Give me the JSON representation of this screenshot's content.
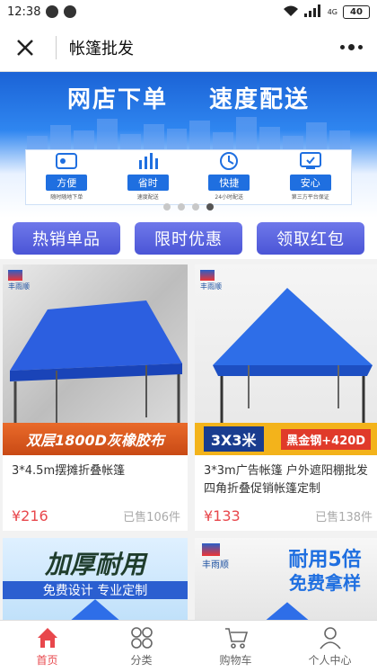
{
  "status": {
    "time": "12:38",
    "battery": "40",
    "network": "4G"
  },
  "nav": {
    "title": "帐篷批发"
  },
  "banner": {
    "headline_left": "网店下单",
    "headline_right": "速度配送",
    "features": [
      {
        "tag": "方便",
        "sub": "随时随地下单",
        "icon": "document-icon"
      },
      {
        "tag": "省时",
        "sub": "速度配送",
        "icon": "chart-icon"
      },
      {
        "tag": "快捷",
        "sub": "24小时配送",
        "icon": "truck-icon"
      },
      {
        "tag": "安心",
        "sub": "第三方平台保证",
        "icon": "monitor-icon"
      }
    ]
  },
  "quick_buttons": [
    "热销单品",
    "限时优惠",
    "领取红包"
  ],
  "products": [
    {
      "name": "3*4.5m摆摊折叠帐篷",
      "price": "¥216",
      "sold": "已售106件",
      "brand": "丰雨顺",
      "banner_text": "双层1800D灰橡胶布"
    },
    {
      "name": "3*3m广告帐篷 户外遮阳棚批发 四角折叠促销帐篷定制",
      "price": "¥133",
      "sold": "已售138件",
      "brand": "丰雨顺",
      "banner_text_left": "3X3米",
      "banner_text_right": "黑金钢+420D"
    },
    {
      "name": "",
      "price": "",
      "sold": "",
      "banner_text": "加厚耐用",
      "sub_text": "免费设计 专业定制"
    },
    {
      "name": "",
      "price": "",
      "sold": "",
      "brand": "丰雨顺",
      "banner_text": "耐用5倍",
      "sub_text": "免费拿样"
    }
  ],
  "tabs": [
    {
      "label": "首页",
      "icon": "home-icon",
      "active": true
    },
    {
      "label": "分类",
      "icon": "category-icon",
      "active": false
    },
    {
      "label": "购物车",
      "icon": "cart-icon",
      "active": false
    },
    {
      "label": "个人中心",
      "icon": "user-icon",
      "active": false
    }
  ],
  "colors": {
    "accent": "#e8474c",
    "button": "#5a63de",
    "banner": "#1f6fe0"
  }
}
